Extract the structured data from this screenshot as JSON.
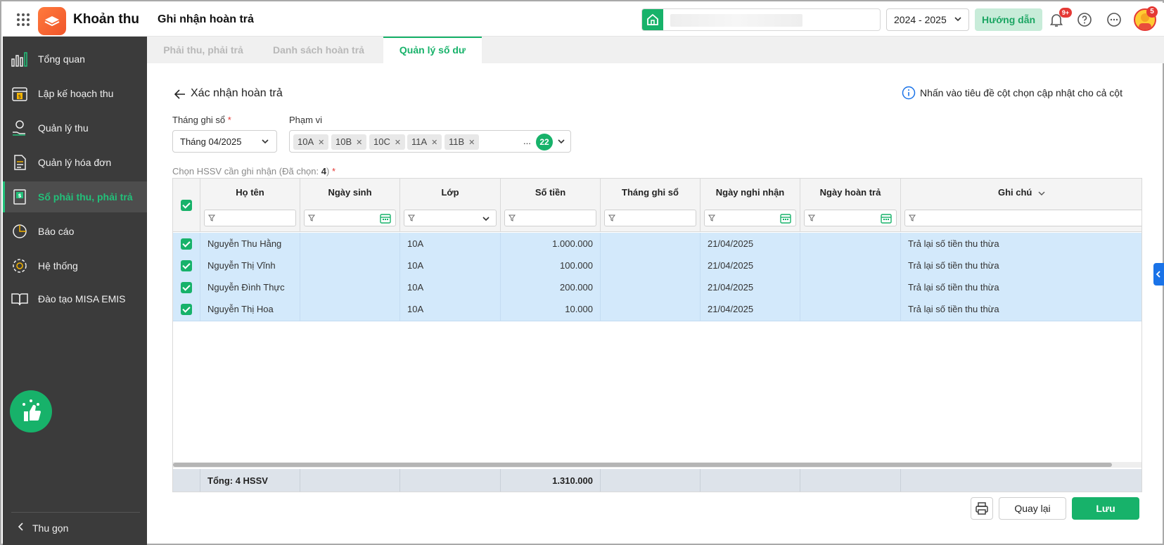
{
  "header": {
    "app_name": "Khoản thu",
    "page_title": "Ghi nhận hoàn trả",
    "year": "2024 - 2025",
    "guide_label": "Hướng dẫn",
    "notification_badge": "9+",
    "avatar_badge": "5",
    "colors": {
      "brand": "#17b26a",
      "accent_orange": "#f0552a"
    }
  },
  "sidebar": {
    "items": [
      {
        "label": "Tổng quan",
        "icon": "chart-bars-icon"
      },
      {
        "label": "Lập kế hoạch thu",
        "icon": "calendar-dollar-icon"
      },
      {
        "label": "Quản lý thu",
        "icon": "hand-coin-icon"
      },
      {
        "label": "Quản lý hóa đơn",
        "icon": "invoice-icon"
      },
      {
        "label": "Sổ phải thu, phải trả",
        "icon": "ledger-book-icon",
        "active": true
      },
      {
        "label": "Báo cáo",
        "icon": "pie-chart-icon"
      },
      {
        "label": "Hệ thống",
        "icon": "gear-icon"
      },
      {
        "label": "Đào tạo MISA EMIS",
        "icon": "open-book-icon"
      }
    ],
    "collapse_label": "Thu gọn"
  },
  "tabs": [
    {
      "label": "Phải thu, phải trả"
    },
    {
      "label": "Danh sách hoàn trả"
    },
    {
      "label": "Quản lý số dư",
      "active": true
    }
  ],
  "main": {
    "back_title": "Xác nhận hoàn trả",
    "hint": "Nhấn vào tiêu đề cột chọn cập nhật cho cả cột",
    "month_label": "Tháng ghi sổ",
    "month_value": "Tháng 04/2025",
    "scope_label": "Phạm vi",
    "scope_chips": [
      "10A",
      "10B",
      "10C",
      "11A",
      "11B"
    ],
    "scope_more": "...",
    "scope_count": "22",
    "select_label": "Chọn HSSV cần ghi nhận (Đã chọn: ",
    "select_count": "4",
    "select_label_end": ")"
  },
  "table": {
    "columns": [
      "Họ tên",
      "Ngày sinh",
      "Lớp",
      "Số tiền",
      "Tháng ghi sổ",
      "Ngày nghi nhận",
      "Ngày hoàn trả",
      "Ghi chú"
    ],
    "rows": [
      {
        "name": "Nguyễn Thu Hằng",
        "dob": "",
        "class": "10A",
        "amount": "1.000.000",
        "month": "",
        "recorded": "21/04/2025",
        "refund": "",
        "note": "Trả lại số tiền thu thừa"
      },
      {
        "name": "Nguyễn Thị Vĩnh",
        "dob": "",
        "class": "10A",
        "amount": "100.000",
        "month": "",
        "recorded": "21/04/2025",
        "refund": "",
        "note": "Trả lại số tiền thu thừa"
      },
      {
        "name": "Nguyễn Đình Thực",
        "dob": "",
        "class": "10A",
        "amount": "200.000",
        "month": "",
        "recorded": "21/04/2025",
        "refund": "",
        "note": "Trả lại số tiền thu thừa"
      },
      {
        "name": "Nguyễn Thị Hoa",
        "dob": "",
        "class": "10A",
        "amount": "10.000",
        "month": "",
        "recorded": "21/04/2025",
        "refund": "",
        "note": "Trả lại số tiền thu thừa"
      }
    ],
    "footer_label": "Tổng: 4 HSSV",
    "footer_total": "1.310.000"
  },
  "actions": {
    "back_label": "Quay lại",
    "save_label": "Lưu"
  }
}
